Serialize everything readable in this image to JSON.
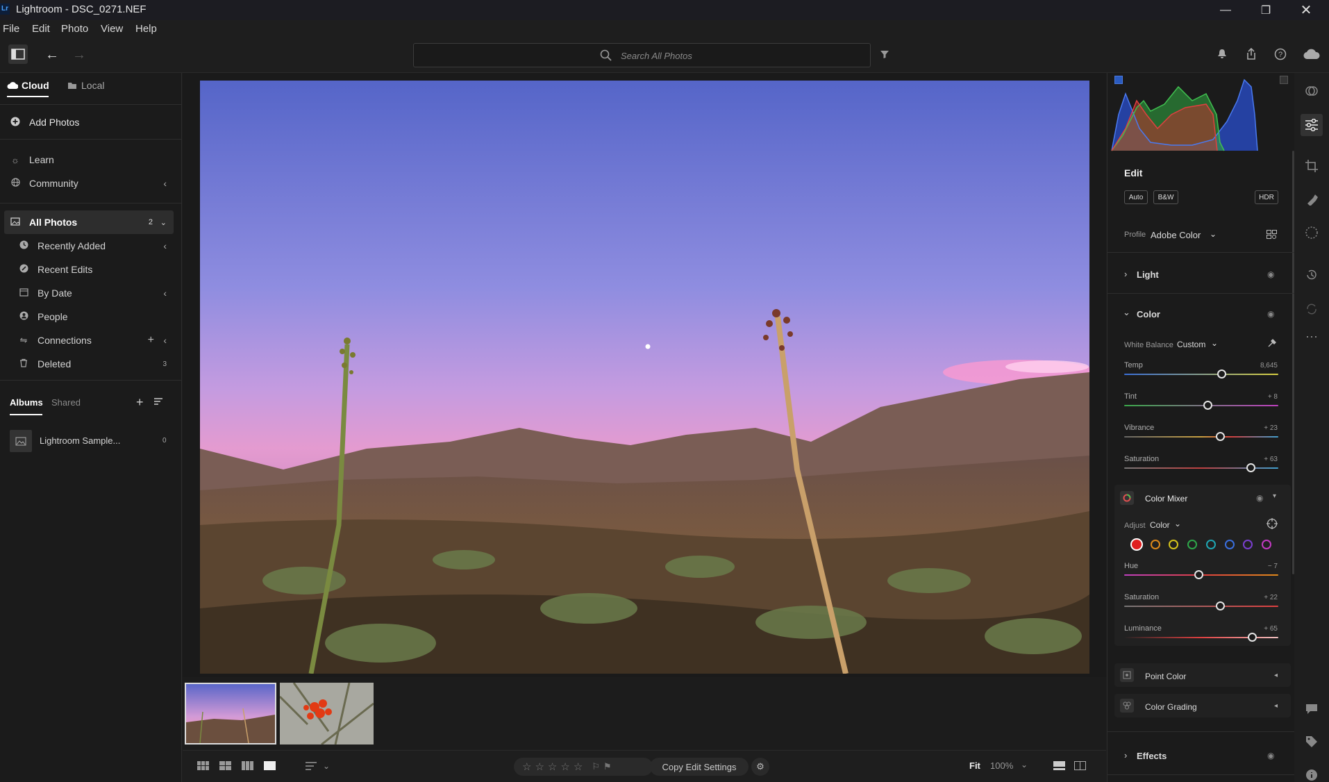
{
  "window": {
    "logo": "Lr",
    "title": "Lightroom - DSC_0271.NEF"
  },
  "menu": [
    "File",
    "Edit",
    "Photo",
    "View",
    "Help"
  ],
  "search": {
    "placeholder": "Search All Photos"
  },
  "left": {
    "tabs": {
      "cloud": "Cloud",
      "local": "Local"
    },
    "add_photos": "Add Photos",
    "learn": "Learn",
    "community": "Community",
    "all_photos": {
      "label": "All Photos",
      "count": "2"
    },
    "items": [
      {
        "label": "Recently Added",
        "icon": "clock-icon"
      },
      {
        "label": "Recent Edits",
        "icon": "edit-history-icon"
      },
      {
        "label": "By Date",
        "icon": "calendar-icon"
      },
      {
        "label": "People",
        "icon": "person-icon"
      },
      {
        "label": "Connections",
        "icon": "connections-icon"
      },
      {
        "label": "Deleted",
        "icon": "trash-icon",
        "count": "3"
      }
    ],
    "album_tabs": {
      "albums": "Albums",
      "shared": "Shared"
    },
    "album": {
      "name": "Lightroom Sample...",
      "count": "0"
    }
  },
  "edit": {
    "title": "Edit",
    "buttons": {
      "auto": "Auto",
      "bw": "B&W",
      "hdr": "HDR"
    },
    "profile": {
      "label": "Profile",
      "value": "Adobe Color"
    },
    "light": "Light",
    "color": "Color",
    "white_balance": {
      "label": "White Balance",
      "value": "Custom"
    },
    "sliders": [
      {
        "label": "Temp",
        "value": "8,645",
        "pos": 0.63
      },
      {
        "label": "Tint",
        "value": "+ 8",
        "pos": 0.54
      },
      {
        "label": "Vibrance",
        "value": "+ 23",
        "pos": 0.62
      },
      {
        "label": "Saturation",
        "value": "+ 63",
        "pos": 0.82
      }
    ],
    "color_mixer": {
      "title": "Color Mixer",
      "adjust_label": "Adjust",
      "adjust_value": "Color",
      "swatches": [
        "#e02020",
        "#e08a1a",
        "#d8c51c",
        "#2ea84a",
        "#1fa7b4",
        "#3a6fe0",
        "#7a3fd0",
        "#c43ac4"
      ],
      "sliders": [
        {
          "label": "Hue",
          "value": "− 7",
          "pos": 0.48
        },
        {
          "label": "Saturation",
          "value": "+ 22",
          "pos": 0.62
        },
        {
          "label": "Luminance",
          "value": "+ 65",
          "pos": 0.83
        }
      ]
    },
    "point_color": "Point Color",
    "color_grading": "Color Grading",
    "effects": "Effects"
  },
  "bottom": {
    "copy_edit": "Copy Edit Settings",
    "fit": "Fit",
    "zoom": "100%"
  }
}
